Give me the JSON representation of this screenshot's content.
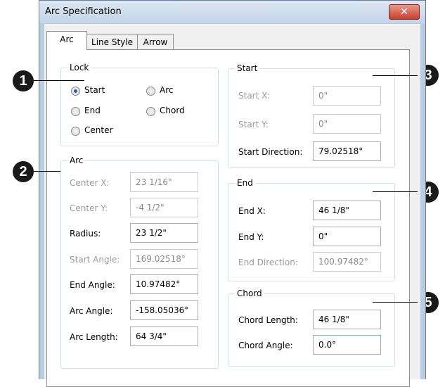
{
  "window": {
    "title": "Arc Specification",
    "close_icon": "close-icon"
  },
  "tabs": [
    {
      "label": "Arc",
      "active": true
    },
    {
      "label": "Line Style",
      "active": false
    },
    {
      "label": "Arrow",
      "active": false
    }
  ],
  "lock": {
    "title": "Lock",
    "options": [
      {
        "label": "Start",
        "checked": true
      },
      {
        "label": "Arc",
        "checked": false
      },
      {
        "label": "End",
        "checked": false
      },
      {
        "label": "Chord",
        "checked": false
      },
      {
        "label": "Center",
        "checked": false
      }
    ]
  },
  "arc": {
    "title": "Arc",
    "rows": [
      {
        "label": "Center X:",
        "value": "23 1/16\"",
        "enabled": false
      },
      {
        "label": "Center Y:",
        "value": "-4 1/2\"",
        "enabled": false
      },
      {
        "label": "Radius:",
        "value": "23 1/2\"",
        "enabled": true
      },
      {
        "label": "Start Angle:",
        "value": "169.02518°",
        "enabled": false
      },
      {
        "label": "End Angle:",
        "value": "10.97482°",
        "enabled": true
      },
      {
        "label": "Arc Angle:",
        "value": "-158.05036°",
        "enabled": true
      },
      {
        "label": "Arc Length:",
        "value": "64 3/4\"",
        "enabled": true
      }
    ]
  },
  "start": {
    "title": "Start",
    "rows": [
      {
        "label": "Start X:",
        "value": "0\"",
        "enabled": false
      },
      {
        "label": "Start Y:",
        "value": "0\"",
        "enabled": false
      },
      {
        "label": "Start Direction:",
        "value": "79.02518°",
        "enabled": true
      }
    ]
  },
  "end": {
    "title": "End",
    "rows": [
      {
        "label": "End X:",
        "value": "46 1/8\"",
        "enabled": true
      },
      {
        "label": "End Y:",
        "value": "0\"",
        "enabled": true
      },
      {
        "label": "End Direction:",
        "value": "100.97482°",
        "enabled": false
      }
    ]
  },
  "chord": {
    "title": "Chord",
    "rows": [
      {
        "label": "Chord Length:",
        "value": "46 1/8\"",
        "enabled": true
      },
      {
        "label": "Chord Angle:",
        "value": "0.0°",
        "enabled": true
      }
    ]
  },
  "callouts": [
    "1",
    "2",
    "3",
    "4",
    "5"
  ]
}
